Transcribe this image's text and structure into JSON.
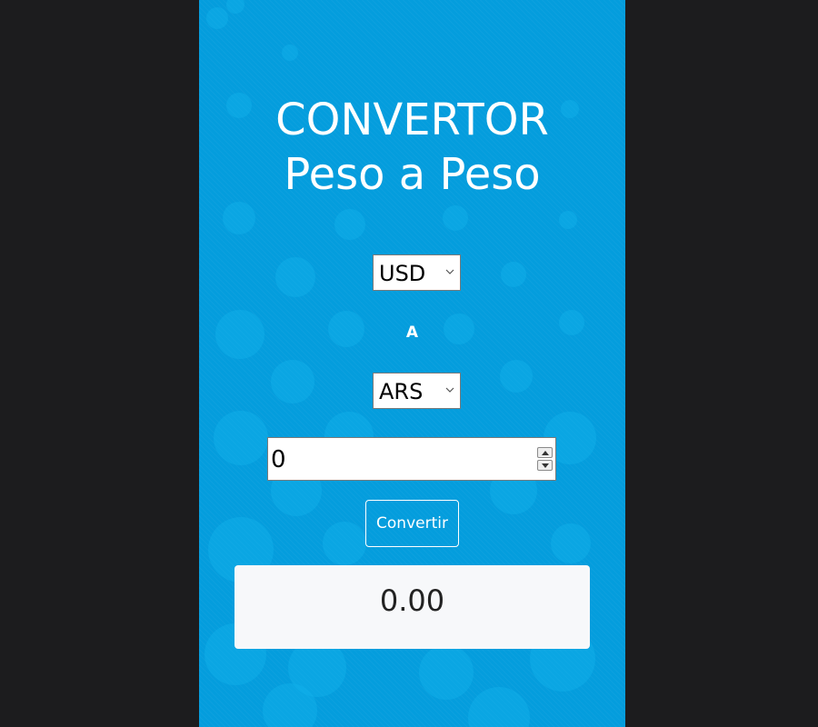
{
  "header": {
    "title_line1": "CONVERTOR",
    "title_line2": "Peso a Peso"
  },
  "form": {
    "from_currency": "USD",
    "separator": "A",
    "to_currency": "ARS",
    "amount": "0",
    "convert_label": "Convertir"
  },
  "result": {
    "value": "0.00"
  },
  "colors": {
    "page_background": "#1c1c1e",
    "panel_background": "#049ddd",
    "result_background": "#f7f8fa"
  },
  "icons": [
    "chevron-down-icon",
    "spin-up-icon",
    "spin-down-icon"
  ]
}
